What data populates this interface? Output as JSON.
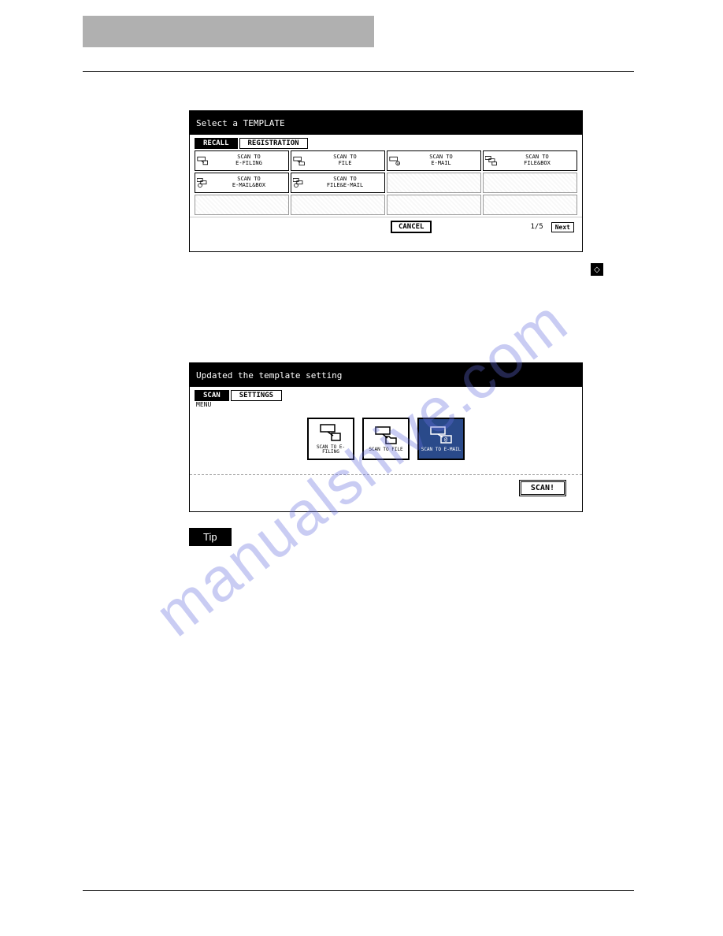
{
  "screen1": {
    "title": "Select a TEMPLATE",
    "tabs": {
      "recall": "RECALL",
      "registration": "REGISTRATION"
    },
    "templates": {
      "scan_efiling": "SCAN TO\nE-FILING",
      "scan_file": "SCAN TO\nFILE",
      "scan_email": "SCAN TO\nE-MAIL",
      "scan_filebox": "SCAN TO\nFILE&BOX",
      "scan_emailbox": "SCAN TO\nE-MAIL&BOX",
      "scan_fileemail": "SCAN TO\nFILE&E-MAIL"
    },
    "cancel": "CANCEL",
    "page": "1/5",
    "next": "Next"
  },
  "screen2": {
    "title": "Updated the template setting",
    "tabs": {
      "scan": "SCAN",
      "settings": "SETTINGS"
    },
    "menu_label": "MENU",
    "buttons": {
      "efiling": "SCAN TO\nE-FILING",
      "file": "SCAN TO\nFILE",
      "email": "SCAN TO\nE-MAIL"
    },
    "scan_action": "SCAN!"
  },
  "tip_label": "Tip",
  "watermark": "manualshive.com"
}
